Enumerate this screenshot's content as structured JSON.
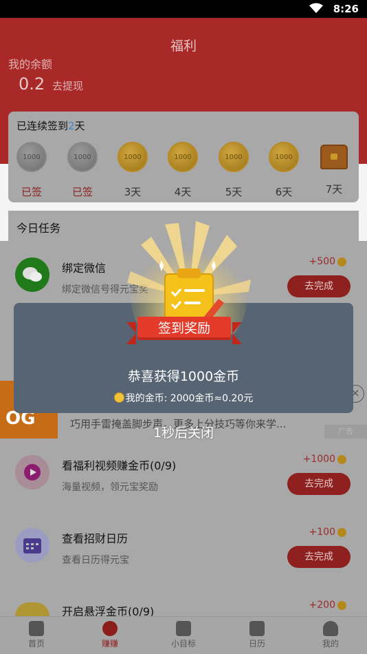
{
  "status": {
    "time": "8:26"
  },
  "header": {
    "title": "福利",
    "balance_label": "我的余额",
    "balance_value": "0.2",
    "withdraw_label": "去提现"
  },
  "checkin": {
    "prefix": "已连续签到",
    "days_count": "2",
    "suffix": "天",
    "days": [
      {
        "coin_text": "1000",
        "label": "已签",
        "signed": true
      },
      {
        "coin_text": "1000",
        "label": "已签",
        "signed": true
      },
      {
        "coin_text": "1000",
        "label": "3天",
        "signed": false
      },
      {
        "coin_text": "1000",
        "label": "4天",
        "signed": false
      },
      {
        "coin_text": "1000",
        "label": "5天",
        "signed": false
      },
      {
        "coin_text": "1000",
        "label": "6天",
        "signed": false
      },
      {
        "coin_text": "",
        "label": "7天",
        "signed": false
      }
    ]
  },
  "tasks_section": {
    "title": "今日任务"
  },
  "tasks": [
    {
      "name": "绑定微信",
      "desc": "绑定微信号得元宝奖",
      "reward": "+500",
      "button": "去完成"
    },
    {
      "name": "看福利视频赚金币(0/9)",
      "desc": "海量视频，领元宝奖励",
      "reward": "+1000",
      "button": "去完成"
    },
    {
      "name": "查看招财日历",
      "desc": "查看日历得元宝",
      "reward": "+100",
      "button": "去完成"
    },
    {
      "name": "开启悬浮金币(0/9)",
      "desc": "",
      "reward": "+200",
      "button": ""
    }
  ],
  "ad": {
    "logo_text": "OG",
    "text": "巧用手雷掩盖脚步声，更多上分技巧等你来学...",
    "badge": "广告",
    "close": "×"
  },
  "dialog": {
    "title": "签到奖励",
    "message": "恭喜获得1000金币",
    "detail": "我的金币: 2000金币≈0.20元",
    "countdown": "1秒后关闭"
  },
  "tabbar": {
    "items": [
      {
        "label": "首页",
        "icon": "home-icon"
      },
      {
        "label": "赚赚",
        "icon": "money-bag-icon",
        "active": true
      },
      {
        "label": "小目标",
        "icon": "target-icon"
      },
      {
        "label": "日历",
        "icon": "calendar-icon"
      },
      {
        "label": "我的",
        "icon": "user-icon"
      }
    ]
  },
  "colors": {
    "accent": "#e33a2a",
    "dimmed_red": "#a92828",
    "coin_gold": "#f1c33a",
    "dialog_bg": "#566473"
  }
}
